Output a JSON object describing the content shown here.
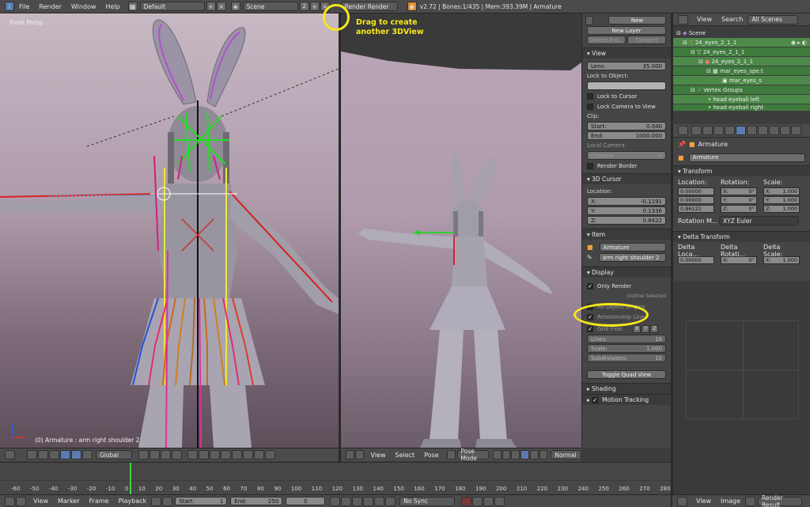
{
  "topbar": {
    "menus": [
      "File",
      "Render",
      "Window",
      "Help"
    ],
    "layout": "Default",
    "scene": "Scene",
    "scene_users": "2",
    "engine": "Render Render",
    "stats": "v2.72 | Bones:1/435 | Mem:393.39M | Armature"
  },
  "viewport_left": {
    "view_label": "Front Persp",
    "status": "(0) Armature : arm right shoulder 2",
    "orientation": "Global"
  },
  "annotations": {
    "drag_hint_line1": "Drag to create",
    "drag_hint_line2": "another 3DView",
    "highlight_color": "#f7e81a"
  },
  "viewport_right": {
    "header_menus": [
      "View",
      "Select",
      "Pose"
    ],
    "mode": "Pose Mode",
    "pivot": "Normal"
  },
  "properties": {
    "new_label": "New",
    "new_layer": "New Layer",
    "delete_frame": "Delete Fra...",
    "convert": "Convert",
    "view_panel": "View",
    "lens_label": "Lens:",
    "lens_value": "35.000",
    "lock_object": "Lock to Object:",
    "lock_cursor": "Lock to Cursor",
    "lock_camera": "Lock Camera to View",
    "clip_label": "Clip:",
    "clip_start_label": "Start:",
    "clip_start": "0.040",
    "clip_end_label": "End:",
    "clip_end": "1000.000",
    "local_camera": "Local Camera",
    "camera": "Camera",
    "render_border": "Render Border",
    "cursor_panel": "3D Cursor",
    "location_label": "Location:",
    "x_label": "X:",
    "x": "-0.1191",
    "y_label": "Y:",
    "y": "0.1336",
    "z_label": "Z:",
    "z": "0.8422",
    "item_panel": "Item",
    "item_object": "Armature",
    "item_bone": "arm right shoulder 2",
    "display_panel": "Display",
    "only_render": "Only Render",
    "outline_selected": "Outline Selected",
    "all_origins": "All Object Origins",
    "relationship_lines": "Relationship Lines",
    "grid_floor": "Grid Floo",
    "grid_x": "X",
    "grid_y": "Y",
    "grid_z": "Z",
    "lines_label": "Lines:",
    "lines": "16",
    "scale_label": "Scale:",
    "scale": "1.000",
    "subdiv_label": "Subdivisions:",
    "subdivisions": "10",
    "toggle_quad": "Toggle Quad View",
    "shading_panel": "Shading",
    "motion_tracking": "Motion Tracking"
  },
  "outliner": {
    "view": "View",
    "search": "Search",
    "filter": "All Scenes",
    "rows": [
      "Scene",
      "24_eyes_2_1_1",
      "24_eyes_2_1_1",
      "24_eyes_2_1_1",
      "mar_eyes_spe.t",
      "mar_eyes_s",
      "Vertex Groups",
      "head eyeball left",
      "head eyeball right"
    ]
  },
  "object_props": {
    "breadcrumb": "Armature",
    "name": "Armature",
    "transform": "Transform",
    "location_label": "Location:",
    "rotation_label": "Rotation:",
    "scale_label": "Scale:",
    "loc": [
      "0.00000",
      "0.00000",
      "0.86122"
    ],
    "rot": [
      "0°",
      "0°",
      "0°"
    ],
    "scl": [
      "1.000",
      "1.000",
      "1.000"
    ],
    "x_label": "X:",
    "y_label": "Y:",
    "z_label": "Z:",
    "rotation_mode_label": "Rotation M...",
    "rotation_mode": "XYZ Euler",
    "delta_transform": "Delta Transform",
    "delta_location": "Delta Loca...",
    "delta_rotation": "Delta Rotati...",
    "delta_scale": "Delta Scale:",
    "delta_loc_x": "0.00000",
    "delta_rot_x": "0°",
    "delta_scale_x": "1.000"
  },
  "timeline": {
    "ticks": [
      "-60",
      "-50",
      "-40",
      "-30",
      "-20",
      "-10",
      "0",
      "10",
      "20",
      "30",
      "40",
      "50",
      "60",
      "70",
      "80",
      "90",
      "100",
      "110",
      "120",
      "130",
      "140",
      "150",
      "160",
      "170",
      "180",
      "190",
      "200",
      "210",
      "220",
      "230",
      "240",
      "250",
      "260",
      "270",
      "280"
    ],
    "menus": [
      "View",
      "Marker",
      "Frame",
      "Playback"
    ],
    "start_label": "Start:",
    "start": "1",
    "end_label": "End:",
    "end": "250",
    "current": "0",
    "sync": "No Sync"
  },
  "image_editor": {
    "menus": [
      "View",
      "Image"
    ],
    "image": "Render Result"
  }
}
